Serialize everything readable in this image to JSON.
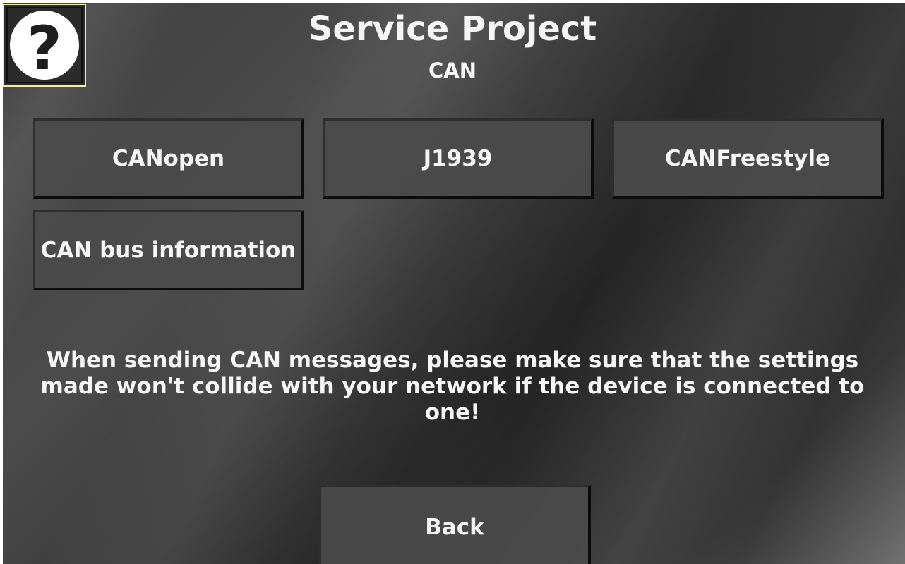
{
  "header": {
    "title": "Service Project",
    "subtitle": "CAN"
  },
  "help_button": {
    "icon": "question-mark-icon",
    "glyph": "?"
  },
  "menu": {
    "canopen_label": "CANopen",
    "j1939_label": "J1939",
    "canfreestyle_label": "CANFreestyle",
    "bus_information_label": "CAN bus information"
  },
  "notice": {
    "text": "When sending CAN messages, please make sure that the settings made won't collide with your network if the device is connected to one!"
  },
  "footer": {
    "back_label": "Back"
  },
  "colors": {
    "help_button_border": "#f0f0a0",
    "text": "#f5f5f5",
    "button_face": "#4b4b4b"
  }
}
